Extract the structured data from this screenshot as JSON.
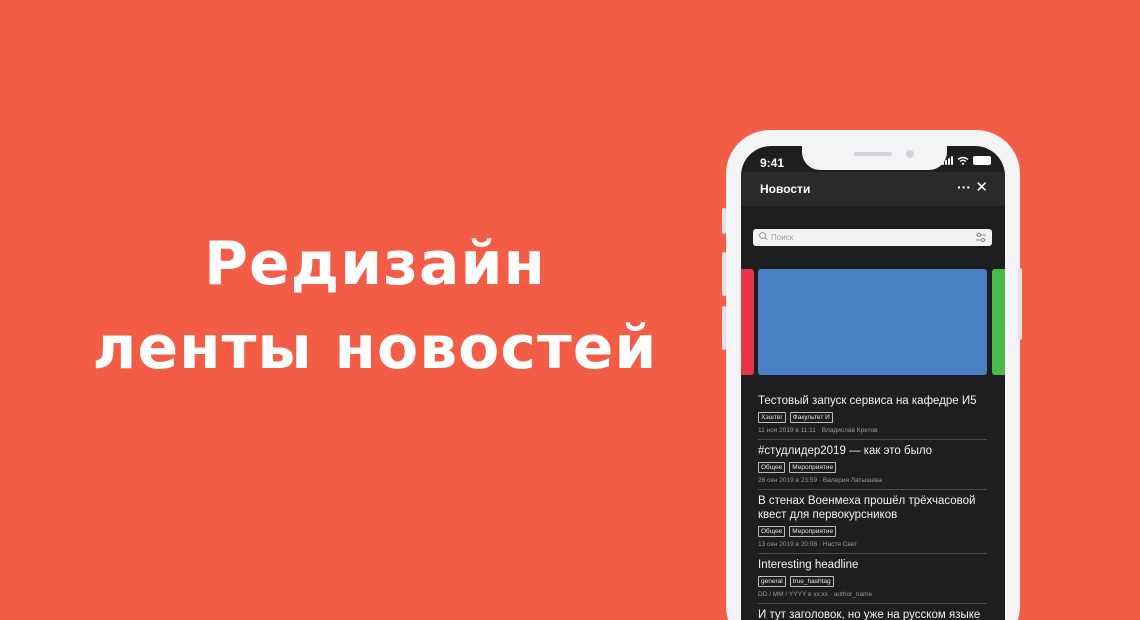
{
  "hero": {
    "line1": "Редизайн",
    "line2": "ленты новостей"
  },
  "status": {
    "time": "9:41"
  },
  "header": {
    "title": "Новости",
    "more_icon": "more-dots-icon",
    "close_icon": "close-icon"
  },
  "search": {
    "placeholder": "Поиск",
    "value": ""
  },
  "carousel": {
    "colors": [
      "#E8334A",
      "#4880C3",
      "#4BBA4B"
    ]
  },
  "news": [
    {
      "title": "Тестовый запуск сервиса на кафедре И5",
      "tags": [
        "Хэштег",
        "Факультет И"
      ],
      "date": "11 ноя 2019 в 11:11",
      "author": "Владислав Кретов"
    },
    {
      "title": "#студлидер2019 — как это было",
      "tags": [
        "Общее",
        "Мероприятие"
      ],
      "date": "26 сен 2019 в 23:59",
      "author": "Валерия Латышева"
    },
    {
      "title": "В стенах Военмеха прошёл трёхчасовой квест для первокурсников",
      "tags": [
        "Общее",
        "Мероприятие"
      ],
      "date": "13 сен 2019 в 20:08",
      "author": "Настя Свет"
    },
    {
      "title": "Interesting headline",
      "tags": [
        "general",
        "true_hashtag"
      ],
      "date": "DD / MM / YYYY в xx:xx",
      "author": "author_name"
    },
    {
      "title": "И тут заголовок, но уже на русском языке",
      "tags": [],
      "date": "",
      "author": ""
    }
  ],
  "colors": {
    "background": "#F45D45",
    "screen": "#1E1E20",
    "header": "#2A2A2C"
  }
}
